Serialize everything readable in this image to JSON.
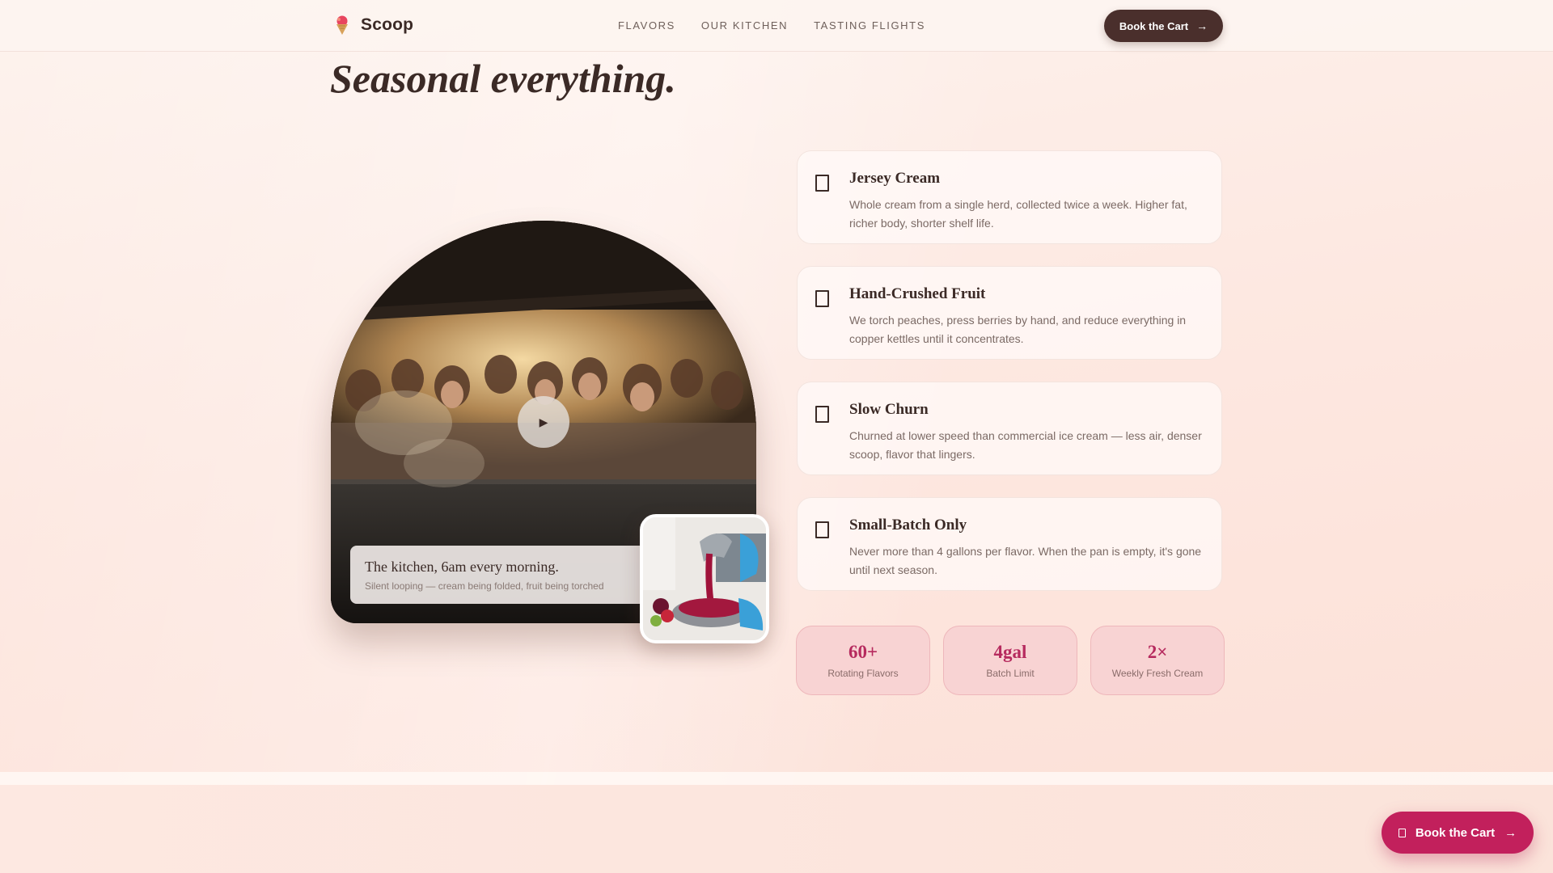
{
  "header": {
    "brand": "Scoop",
    "nav": [
      "FLAVORS",
      "OUR KITCHEN",
      "TASTING FLIGHTS"
    ],
    "cta_label": "Book the Cart"
  },
  "hero": {
    "headline": "Seasonal everything."
  },
  "video": {
    "caption_title": "The kitchen, 6am every morning.",
    "caption_subtitle": "Silent looping — cream being folded, fruit being torched"
  },
  "features": [
    {
      "title": "Jersey Cream",
      "desc": "Whole cream from a single herd, collected twice a week. Higher fat, richer body, shorter shelf life."
    },
    {
      "title": "Hand-Crushed Fruit",
      "desc": "We torch peaches, press berries by hand, and reduce everything in copper kettles until it concentrates."
    },
    {
      "title": "Slow Churn",
      "desc": "Churned at lower speed than commercial ice cream — less air, denser scoop, flavor that lingers."
    },
    {
      "title": "Small-Batch Only",
      "desc": "Never more than 4 gallons per flavor. When the pan is empty, it's gone until next season."
    }
  ],
  "stats": [
    {
      "value": "60+",
      "label": "Rotating Flavors"
    },
    {
      "value": "4gal",
      "label": "Batch Limit"
    },
    {
      "value": "2×",
      "label": "Weekly Fresh Cream"
    }
  ],
  "floating_cta": {
    "label": "Book the Cart"
  },
  "icons": {
    "brand": "ice-cream-icon",
    "arrow": "arrow-right-icon",
    "play": "play-icon",
    "feature": "checkbox-icon"
  },
  "colors": {
    "dark_brown": "#4a2f2c",
    "accent_pink": "#c2205c",
    "stat_value": "#b62a5e",
    "stat_bg": "#f8d3d3"
  }
}
